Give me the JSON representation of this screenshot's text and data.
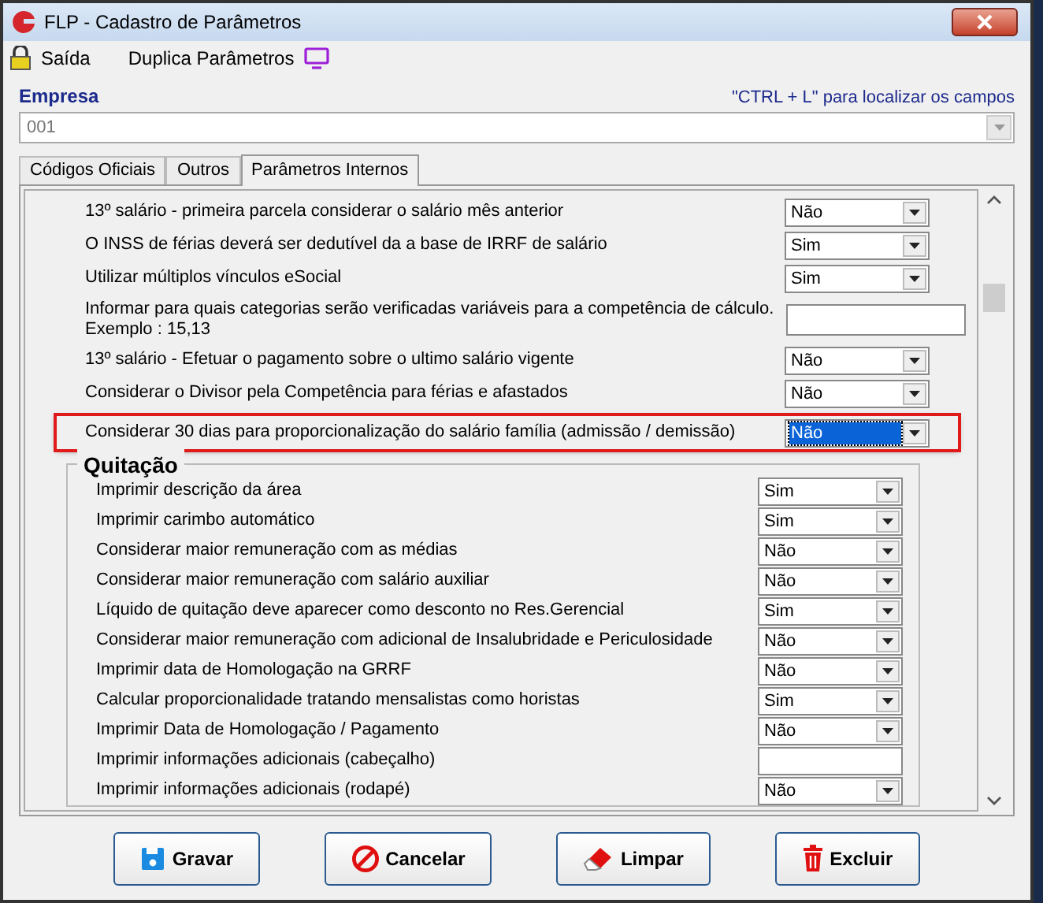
{
  "window": {
    "title": "FLP - Cadastro de Parâmetros"
  },
  "toolbar": [
    {
      "label": "Saída"
    },
    {
      "label": "Duplica Parâmetros"
    }
  ],
  "empresa": {
    "label": "Empresa",
    "hint": "\"CTRL + L\" para localizar os campos",
    "value": "001"
  },
  "tabs": [
    {
      "label": "Códigos Oficiais",
      "selected": false
    },
    {
      "label": "Outros",
      "selected": false
    },
    {
      "label": "Parâmetros Internos",
      "selected": true
    }
  ],
  "params": [
    {
      "kind": "combo",
      "label": "13º salário - primeira parcela considerar o salário mês anterior",
      "value": "Não",
      "highlighted": false,
      "focused": false
    },
    {
      "kind": "combo",
      "label": "O INSS de férias deverá ser dedutível da a base de IRRF de salário",
      "value": "Sim",
      "highlighted": false,
      "focused": false
    },
    {
      "kind": "combo",
      "label": "Utilizar múltiplos vínculos eSocial",
      "value": "Sim",
      "highlighted": false,
      "focused": false
    },
    {
      "kind": "text",
      "label": "Informar para quais categorias serão verificadas variáveis para a competência de cálculo.",
      "note": "Exemplo : 15,13",
      "highlighted": false
    },
    {
      "kind": "combo",
      "label": "13º salário - Efetuar o pagamento sobre o ultimo salário vigente",
      "value": "Não",
      "highlighted": false,
      "focused": false
    },
    {
      "kind": "combo",
      "label": "Considerar o Divisor pela Competência para férias e afastados",
      "value": "Não",
      "highlighted": false,
      "focused": false
    },
    {
      "kind": "combo",
      "label": "Considerar 30 dias para proporcionalização do salário família (admissão / demissão)",
      "value": "Não",
      "highlighted": true,
      "focused": true
    }
  ],
  "quitacao": {
    "title": "Quitação",
    "rows": [
      {
        "kind": "combo",
        "label": "Imprimir descrição da área",
        "value": "Sim"
      },
      {
        "kind": "combo",
        "label": "Imprimir carimbo automático",
        "value": "Sim"
      },
      {
        "kind": "combo",
        "label": "Considerar maior remuneração com as médias",
        "value": "Não"
      },
      {
        "kind": "combo",
        "label": "Considerar maior remuneração com salário auxiliar",
        "value": "Não"
      },
      {
        "kind": "combo",
        "label": "Líquido de quitação deve aparecer como desconto no Res.Gerencial",
        "value": "Sim"
      },
      {
        "kind": "combo",
        "label": "Considerar maior remuneração com adicional de Insalubridade e Periculosidade",
        "value": "Não"
      },
      {
        "kind": "combo",
        "label": "Imprimir data de Homologação na GRRF",
        "value": "Não"
      },
      {
        "kind": "combo",
        "label": "Calcular proporcionalidade tratando mensalistas como horistas",
        "value": "Sim"
      },
      {
        "kind": "combo",
        "label": "Imprimir Data de  Homologação / Pagamento",
        "value": "Não"
      },
      {
        "kind": "text",
        "label": "Imprimir informações adicionais (cabeçalho)"
      },
      {
        "kind": "combo",
        "label": "Imprimir informações adicionais (rodapé)",
        "value": "Não"
      }
    ]
  },
  "buttons": [
    {
      "label": "Gravar"
    },
    {
      "label": "Cancelar"
    },
    {
      "label": "Limpar"
    },
    {
      "label": "Excluir"
    }
  ]
}
